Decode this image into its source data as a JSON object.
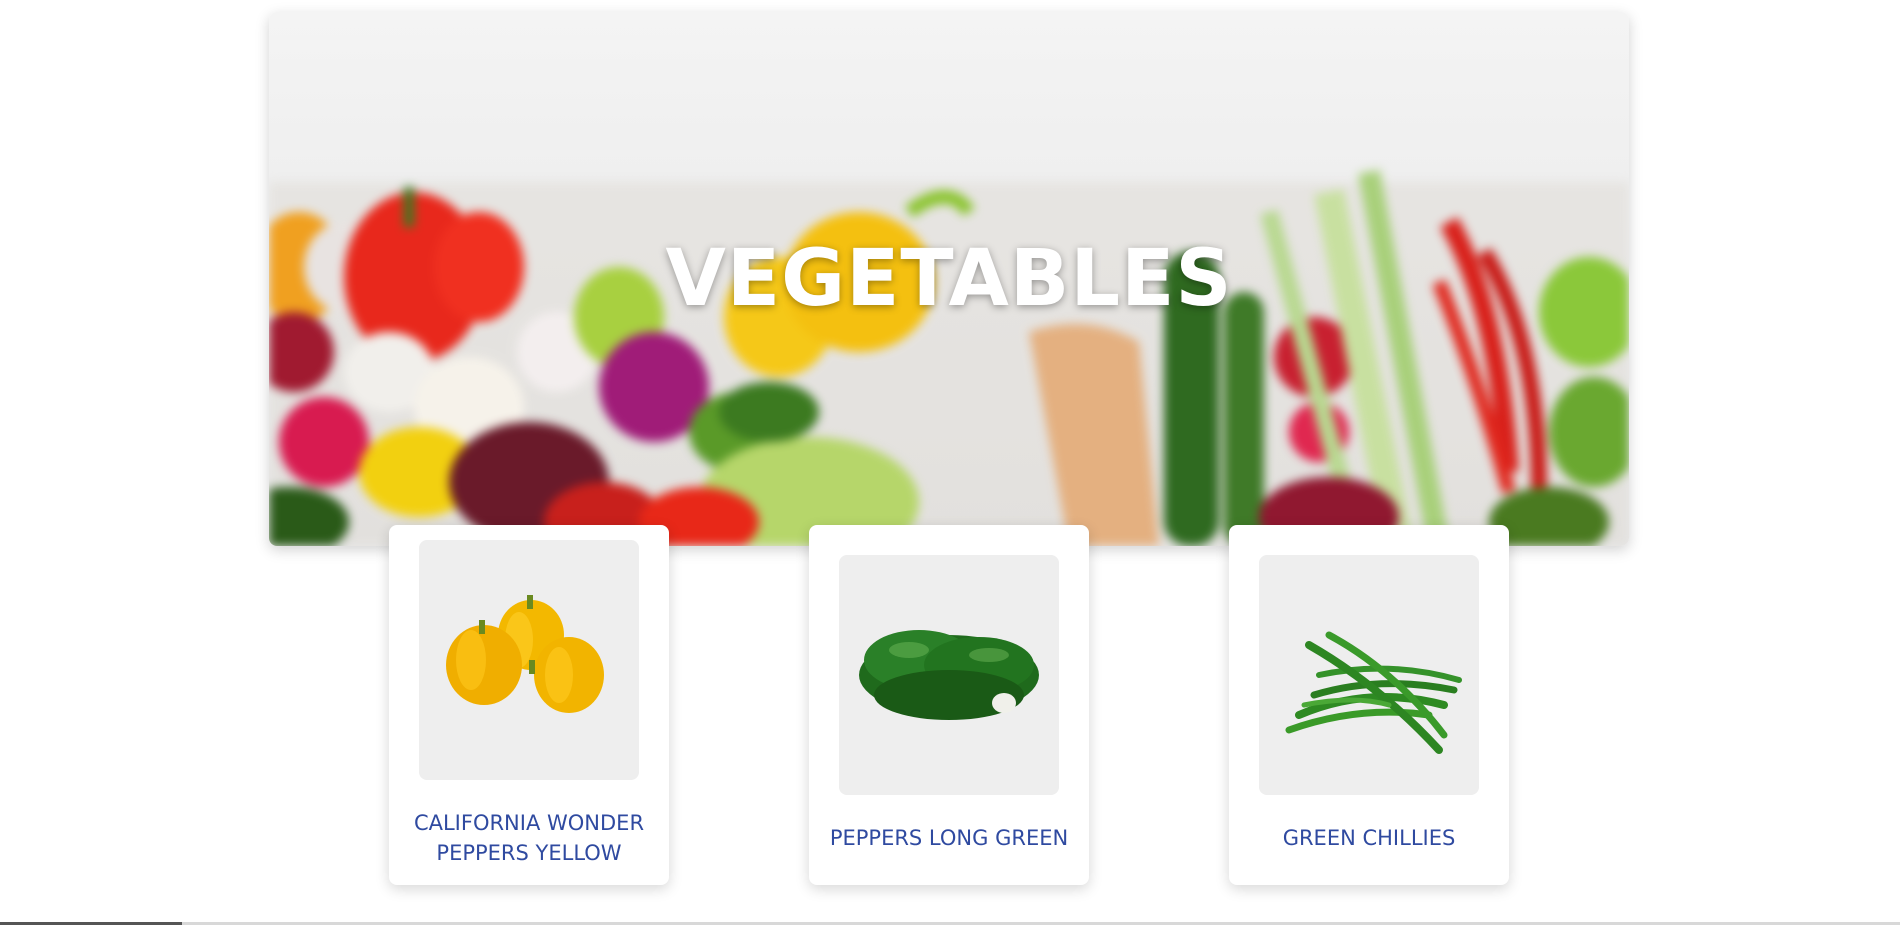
{
  "hero": {
    "title": "VEGETABLES"
  },
  "products": [
    {
      "name": "CALIFORNIA WONDER PEPPERS YELLOW",
      "image_icon": "yellow-peppers-icon"
    },
    {
      "name": "PEPPERS LONG GREEN",
      "image_icon": "green-peppers-icon"
    },
    {
      "name": "GREEN CHILLIES",
      "image_icon": "green-chillies-icon"
    }
  ],
  "colors": {
    "title_text": "#ffffff",
    "product_name": "#2f4aa0",
    "card_image_bg": "#eeeeee"
  }
}
